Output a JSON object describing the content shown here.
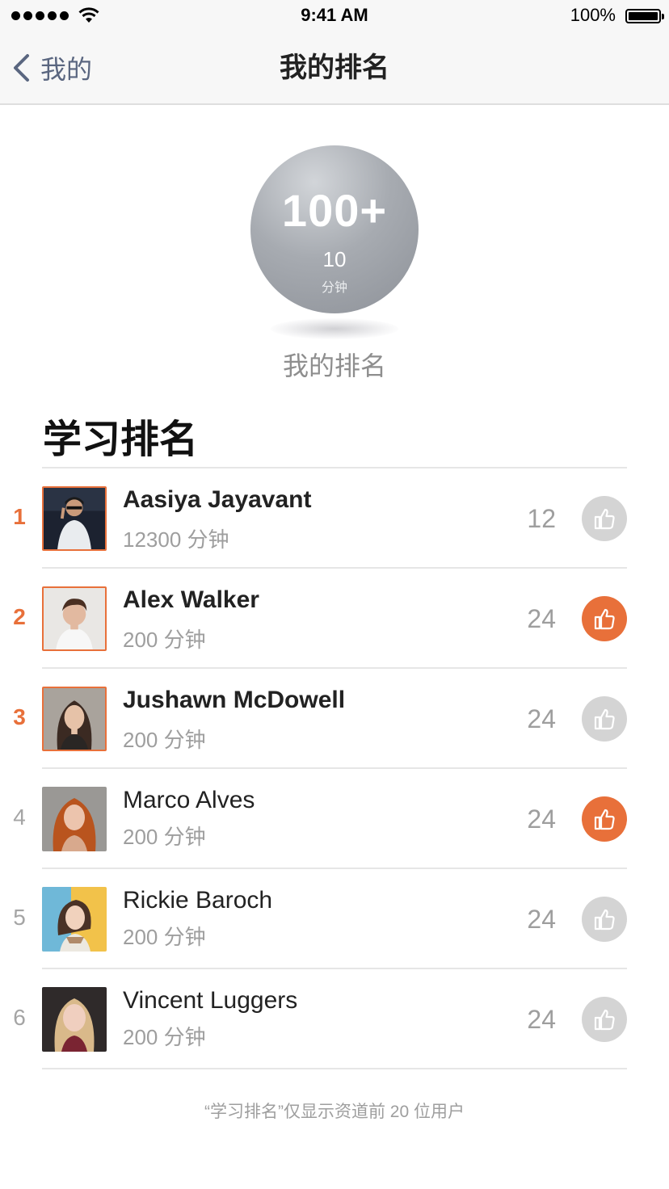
{
  "status_bar": {
    "time": "9:41 AM",
    "battery": "100%"
  },
  "nav": {
    "back_label": "我的",
    "title": "我的排名"
  },
  "my_rank": {
    "rank": "100+",
    "minutes": "10",
    "unit": "分钟",
    "caption": "我的排名"
  },
  "section_title": "学习排名",
  "rankings": [
    {
      "rank": "1",
      "name": "Aasiya Jayavant",
      "minutes": "12300 分钟",
      "likes": "12",
      "liked": false,
      "avatar": "avatar-1"
    },
    {
      "rank": "2",
      "name": "Alex Walker",
      "minutes": "200 分钟",
      "likes": "24",
      "liked": true,
      "avatar": "avatar-2"
    },
    {
      "rank": "3",
      "name": "Jushawn McDowell",
      "minutes": "200 分钟",
      "likes": "24",
      "liked": false,
      "avatar": "avatar-3"
    },
    {
      "rank": "4",
      "name": "Marco Alves",
      "minutes": "200 分钟",
      "likes": "24",
      "liked": true,
      "avatar": "avatar-4"
    },
    {
      "rank": "5",
      "name": "Rickie Baroch",
      "minutes": "200 分钟",
      "likes": "24",
      "liked": false,
      "avatar": "avatar-5"
    },
    {
      "rank": "6",
      "name": "Vincent Luggers",
      "minutes": "200 分钟",
      "likes": "24",
      "liked": false,
      "avatar": "avatar-6"
    }
  ],
  "footer_note": "“学习排名”仅显示资道前 20 位用户",
  "colors": {
    "accent": "#e8703a",
    "like_off": "#d4d4d4",
    "back": "#5a6680"
  },
  "icons": {
    "back": "chevron-left-icon",
    "like": "thumbs-up-icon",
    "signal": "signal-dots-icon",
    "wifi": "wifi-icon",
    "battery": "battery-icon"
  }
}
